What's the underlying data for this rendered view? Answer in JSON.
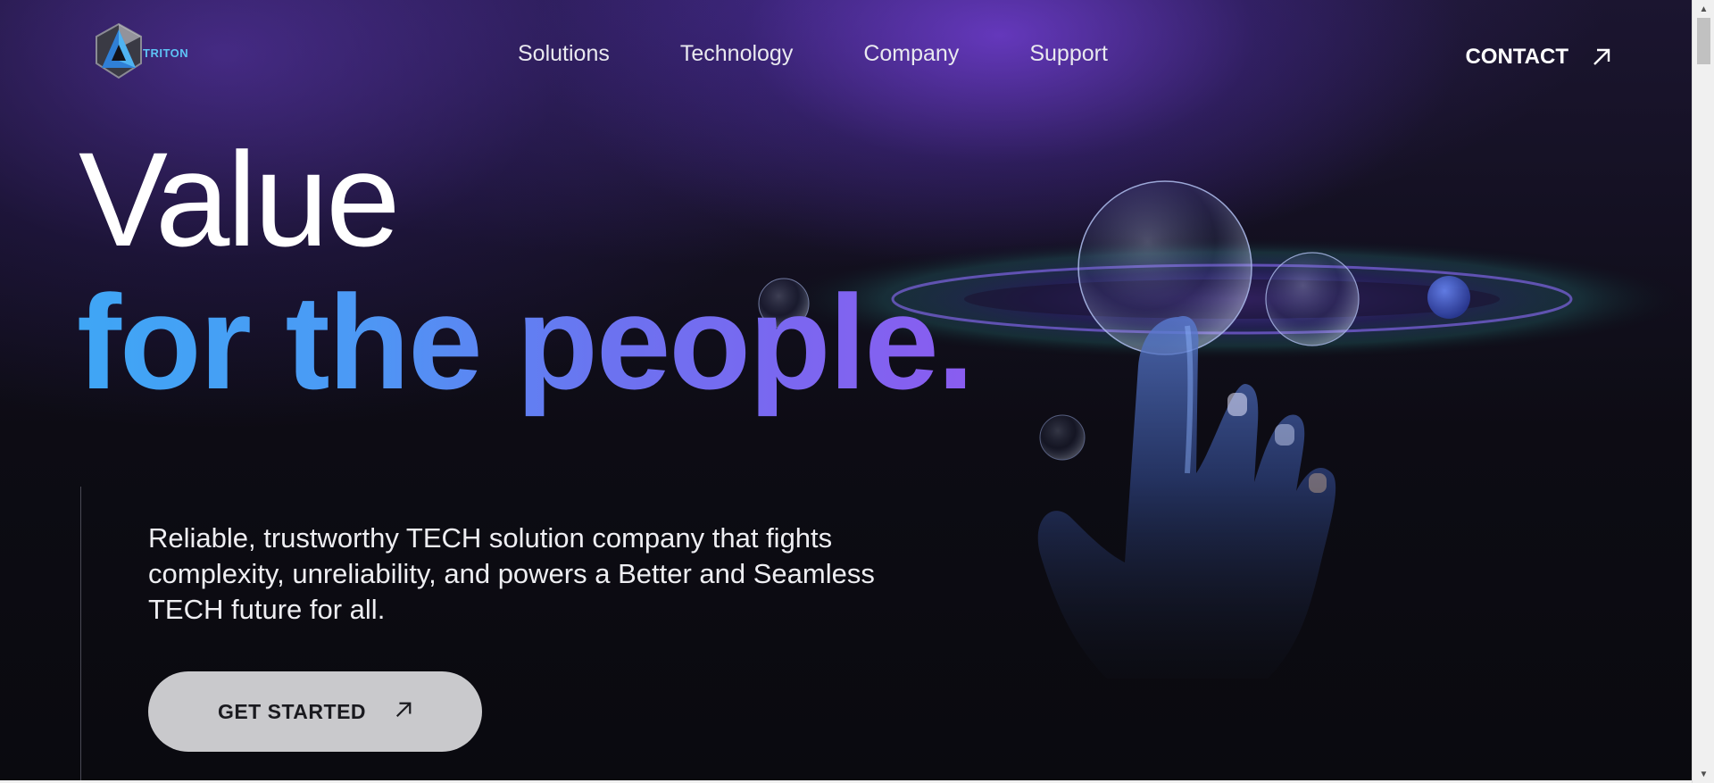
{
  "brand": {
    "name": "TRITON"
  },
  "nav": {
    "links": [
      "Solutions",
      "Technology",
      "Company",
      "Support"
    ],
    "contact_label": "CONTACT"
  },
  "hero": {
    "line1": "Value",
    "line2": "for the people.",
    "description": "Reliable, trustworthy TECH solution company that fights complexity, unreliability, and powers a Better and Seamless TECH future for all.",
    "cta_label": "GET STARTED"
  },
  "colors": {
    "background": "#0a0a10",
    "accent_blue": "#3fa6f5",
    "accent_purple": "#8a5cf0",
    "cta_background": "#c9c9cc"
  },
  "icons": {
    "logo": "triton-logo-icon",
    "contact_arrow": "arrow-up-right-icon",
    "cta_arrow": "arrow-up-right-icon"
  }
}
